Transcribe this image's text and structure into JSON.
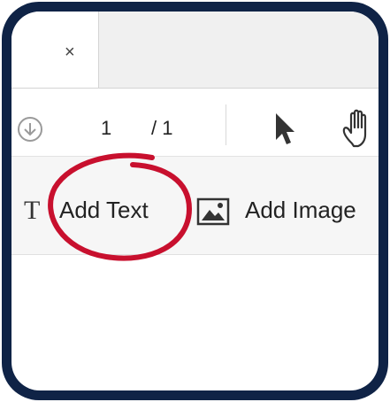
{
  "tabbar": {
    "close_label": "×"
  },
  "pagebar": {
    "download_icon": "download-circle-icon",
    "page_current": "1",
    "page_total": "/ 1",
    "tools": [
      "pointer-icon",
      "hand-icon"
    ]
  },
  "editbar": {
    "add_text_label": "Add Text",
    "add_image_label": "Add Image",
    "text_icon_glyph": "T"
  },
  "colors": {
    "frame": "#0f2346",
    "highlight_circle": "#c8102e",
    "toolbar_bg": "#f6f6f6"
  }
}
